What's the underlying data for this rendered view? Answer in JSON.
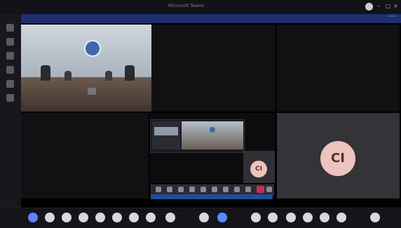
{
  "window": {
    "title": "Microsoft Teams",
    "controls": [
      "–",
      "□",
      "×"
    ]
  },
  "banner": {
    "text": "",
    "button": ""
  },
  "meeting": {
    "tiles": [
      {
        "name": ""
      },
      {
        "name": ""
      },
      {
        "name": ""
      },
      {
        "name": ""
      },
      {
        "name": ""
      }
    ],
    "big_avatar_initials": "CI",
    "small_avatar_initials": "CI"
  },
  "controls_bar": {
    "items": [
      "camera",
      "mic",
      "share",
      "reactions",
      "chat",
      "people",
      "more"
    ],
    "leave_color": "#c4314b"
  },
  "caption": {
    "text": ""
  },
  "taskbar": {
    "apps": [
      "start",
      "search",
      "files",
      "edge",
      "chrome",
      "mail",
      "teams",
      "word",
      "excel",
      "powerpoint",
      "photos",
      "settings",
      "store",
      "calendar",
      "music",
      "maps",
      "onenote",
      "skype"
    ],
    "tray": ""
  }
}
